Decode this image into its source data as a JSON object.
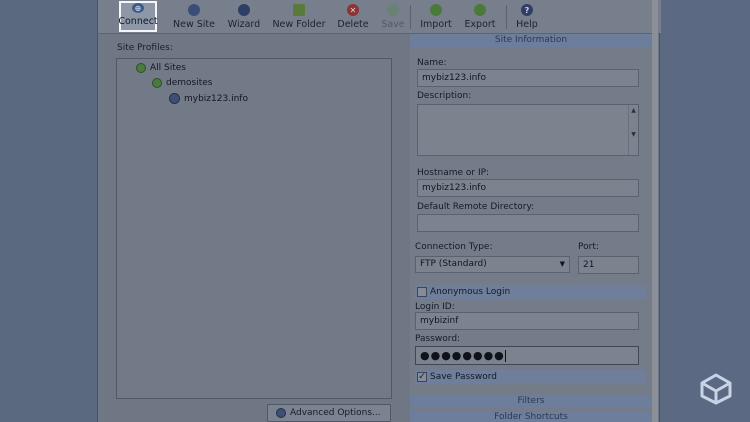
{
  "toolbar": {
    "connect": "Connect",
    "new_site": "New Site",
    "wizard": "Wizard",
    "new_folder": "New Folder",
    "delete": "Delete",
    "save": "Save",
    "import": "Import",
    "export": "Export",
    "help": "Help"
  },
  "left": {
    "profiles_label": "Site Profiles:",
    "tree": [
      "All Sites",
      "demosites",
      "mybiz123.info"
    ],
    "advanced_button": "Advanced Options..."
  },
  "right": {
    "section_site_info": "Site Information",
    "name_label": "Name:",
    "name_value": "mybiz123.info",
    "description_label": "Description:",
    "host_label": "Hostname or IP:",
    "host_value": "mybiz123.info",
    "remote_dir_label": "Default Remote Directory:",
    "remote_dir_value": "",
    "conn_type_label": "Connection Type:",
    "conn_type_value": "FTP (Standard)",
    "port_label": "Port:",
    "port_value": "21",
    "anonymous_label": "Anonymous Login",
    "login_label": "Login ID:",
    "login_value": "mybizinf",
    "password_label": "Password:",
    "password_value": "●●●●●●●●",
    "save_password_label": "Save Password",
    "section_filters": "Filters",
    "section_shortcuts": "Folder Shortcuts"
  },
  "colors": {
    "overlay_bg": "#5e6b80",
    "section_header": "#6c7e9c",
    "selected_border": "#f4f6fa"
  },
  "icons": [
    "connect-icon",
    "new-site-icon",
    "wizard-icon",
    "new-folder-icon",
    "delete-icon",
    "save-icon",
    "import-icon",
    "export-icon",
    "help-icon",
    "folder-icon",
    "globe-icon",
    "logo-icon"
  ]
}
